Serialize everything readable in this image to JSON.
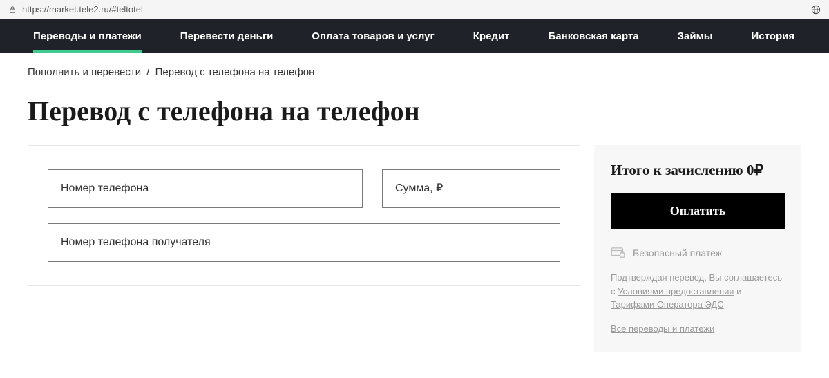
{
  "url": "https://market.tele2.ru/#teltotel",
  "nav": {
    "items": [
      {
        "label": "Переводы и платежи",
        "active": true
      },
      {
        "label": "Перевести деньги",
        "active": false
      },
      {
        "label": "Оплата товаров и услуг",
        "active": false
      },
      {
        "label": "Кредит",
        "active": false
      },
      {
        "label": "Банковская карта",
        "active": false
      },
      {
        "label": "Займы",
        "active": false
      },
      {
        "label": "История",
        "active": false
      }
    ]
  },
  "breadcrumb": {
    "parent": "Пополнить и перевести",
    "separator": "/",
    "current": "Перевод с телефона на телефон"
  },
  "page_title": "Перевод с телефона на телефон",
  "form": {
    "phone_placeholder": "Номер телефона",
    "amount_placeholder": "Сумма, ₽",
    "recipient_placeholder": "Номер телефона получателя"
  },
  "sidebar": {
    "total_label": "Итого к зачислению 0₽",
    "pay_button": "Оплатить",
    "secure_label": "Безопасный платеж",
    "disclaimer_prefix": "Подтверждая перевод, Вы соглашаетесь с ",
    "disclaimer_link1": "Условиями предоставления",
    "disclaimer_mid": " и ",
    "disclaimer_link2": "Тарифами Оператора ЭДС",
    "all_link": "Все переводы и платежи"
  }
}
